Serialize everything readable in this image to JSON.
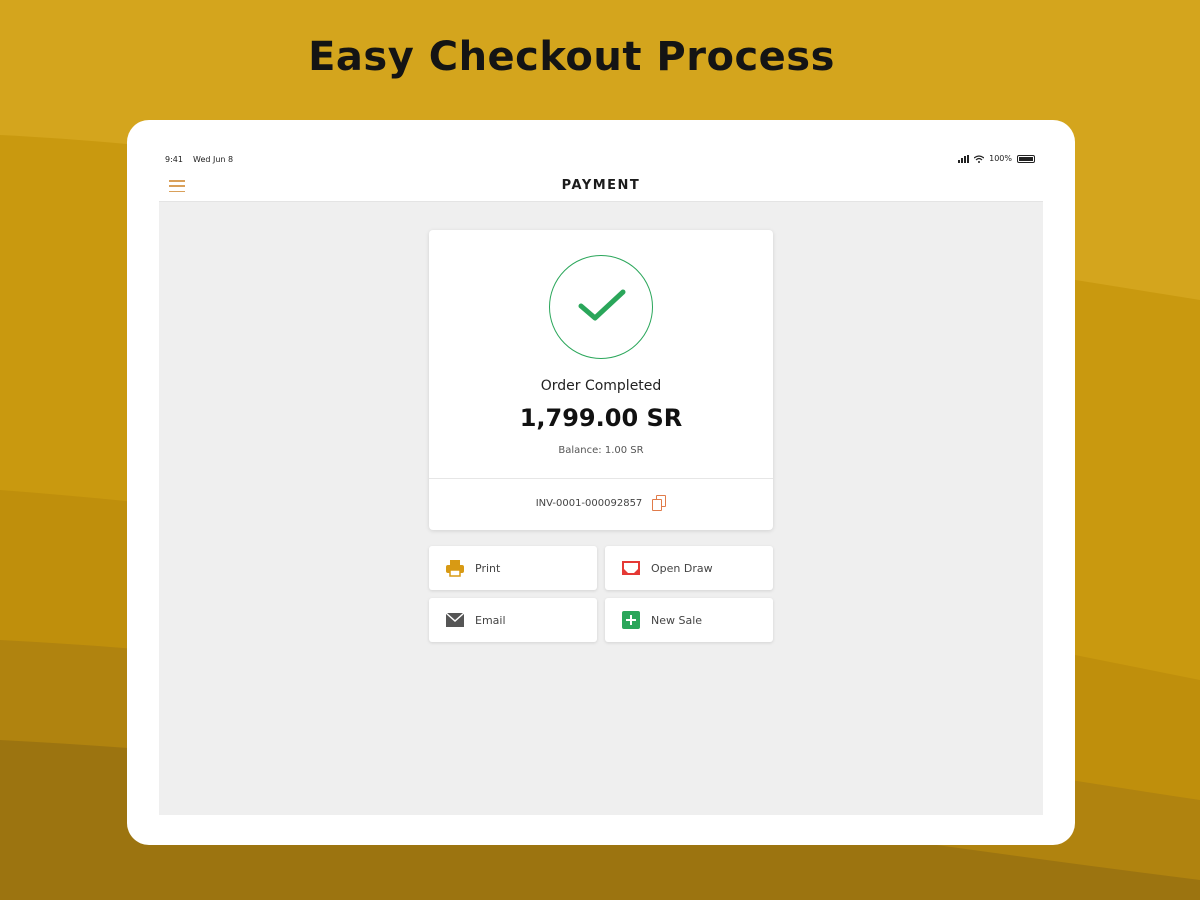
{
  "headline": "Easy Checkout Process",
  "status_bar": {
    "time": "9:41",
    "date": "Wed Jun 8",
    "battery": "100%"
  },
  "navbar": {
    "title": "PAYMENT"
  },
  "order": {
    "status": "Order Completed",
    "amount": "1,799.00 SR",
    "balance": "Balance: 1.00 SR",
    "invoice": "INV-0001-000092857"
  },
  "actions": [
    {
      "label": "Print",
      "icon": "printer-icon"
    },
    {
      "label": "Open Draw",
      "icon": "drawer-icon"
    },
    {
      "label": "Email",
      "icon": "mail-icon"
    },
    {
      "label": "New Sale",
      "icon": "plus-square-icon"
    }
  ],
  "colors": {
    "background": "#c99d14",
    "success_green": "#2aa65a",
    "copy_icon": "#e07b4a",
    "print_icon": "#d89a14",
    "draw_icon": "#e53935",
    "new_sale_icon": "#2aa65a"
  }
}
